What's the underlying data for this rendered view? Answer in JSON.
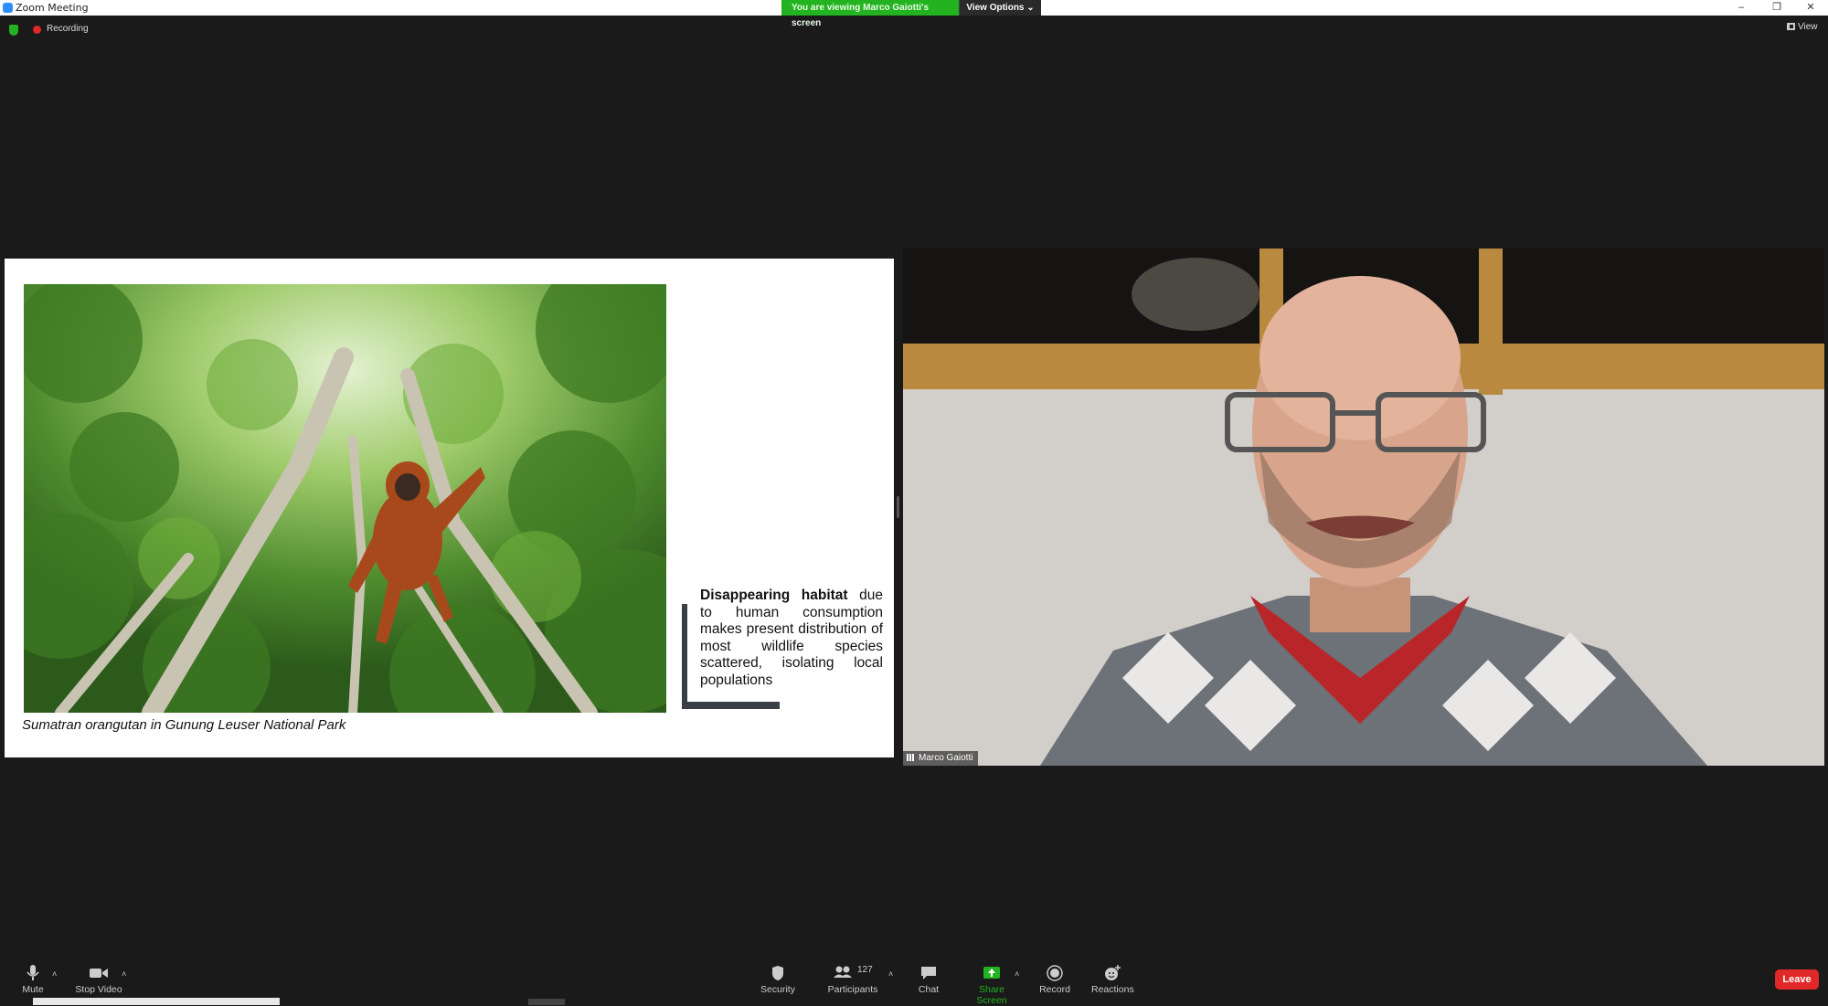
{
  "window": {
    "title": "Zoom Meeting"
  },
  "banner": {
    "viewing_text": "You are viewing Marco Gaiotti's screen",
    "view_options_label": "View Options ⌄"
  },
  "status": {
    "recording_label": "Recording",
    "view_label": "View"
  },
  "slide": {
    "caption": "Sumatran orangutan in Gunung Leuser National Park",
    "habitat_bold": "Disappearing habitat",
    "habitat_rest": " due to human consumption makes present distribution of most wildlife species scattered, isolating local populations"
  },
  "video": {
    "participant_name": "Marco Gaiotti"
  },
  "toolbar": {
    "mute_label": "Mute",
    "stop_video_label": "Stop Video",
    "security_label": "Security",
    "participants_label": "Participants",
    "participants_count": "127",
    "chat_label": "Chat",
    "share_screen_label": "Share Screen",
    "record_label": "Record",
    "reactions_label": "Reactions",
    "leave_label": "Leave"
  },
  "colors": {
    "accent_green": "#23b320",
    "leave_red": "#e02828",
    "background": "#1a1a1a"
  }
}
